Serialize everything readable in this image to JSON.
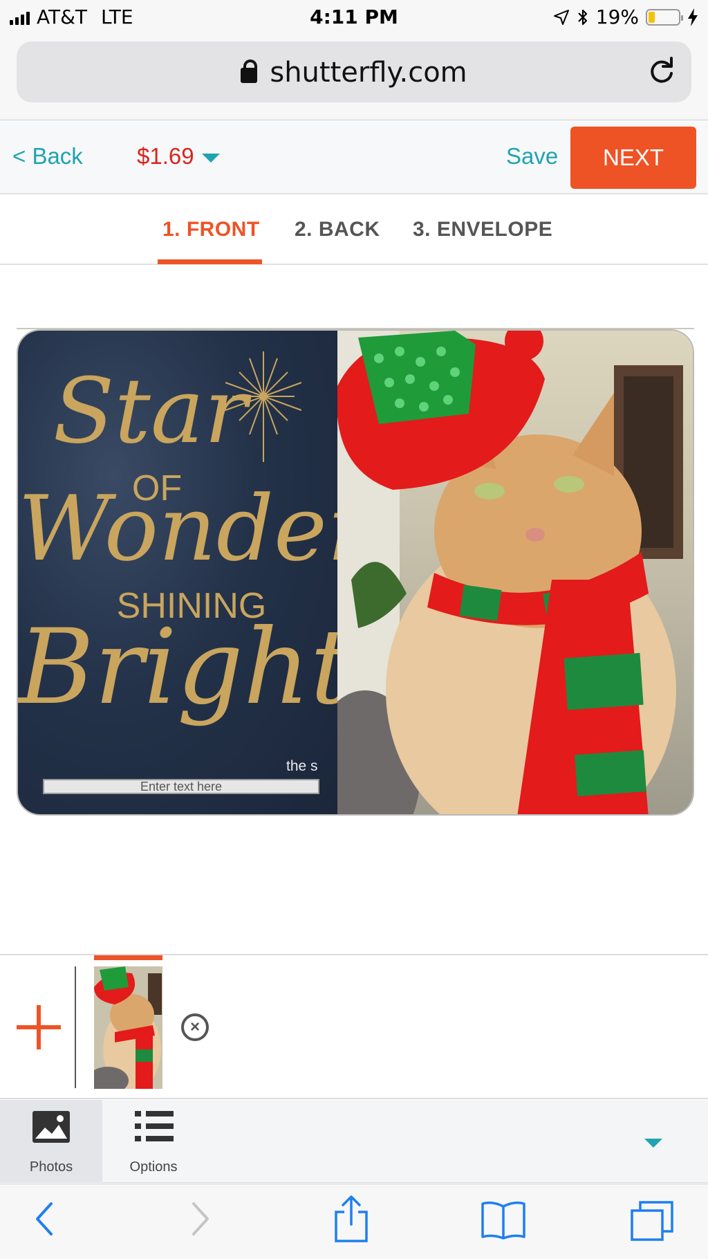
{
  "status_bar": {
    "carrier": "AT&T",
    "network": "LTE",
    "time": "4:11 PM",
    "battery_percent": "19%",
    "battery_level": 0.19,
    "icons": [
      "signal-bars-icon",
      "location-arrow-icon",
      "bluetooth-icon",
      "battery-icon",
      "charging-bolt-icon"
    ]
  },
  "browser": {
    "url": "shutterfly.com",
    "icons": [
      "lock-icon",
      "reload-icon"
    ]
  },
  "header": {
    "back_label": "< Back",
    "price": "$1.69",
    "save_label": "Save",
    "next_label": "NEXT"
  },
  "tabs": [
    {
      "label": "1. FRONT",
      "active": true
    },
    {
      "label": "2. BACK",
      "active": false
    },
    {
      "label": "3. ENVELOPE",
      "active": false
    }
  ],
  "card": {
    "text_line1": "Star",
    "text_line2": "OF",
    "text_line3": "Wonder",
    "text_line4": "SHINING",
    "text_line5": "Bright",
    "partial_text": "the s",
    "text_placeholder": "Enter text here"
  },
  "photo_tray": {
    "icons": [
      "add-photo-icon",
      "remove-photo-icon"
    ]
  },
  "tool_tabs": [
    {
      "label": "Photos",
      "icon": "photos-icon",
      "active": true
    },
    {
      "label": "Options",
      "icon": "list-icon",
      "active": false
    }
  ],
  "safari_toolbar": {
    "icons": [
      "back-arrow-icon",
      "forward-arrow-icon",
      "share-icon",
      "bookmarks-icon",
      "tabs-icon"
    ]
  },
  "colors": {
    "accent_orange": "#ee5325",
    "teal": "#1fa3b1",
    "price_red": "#d7261e",
    "gold": "#c9a55e",
    "navy": "#233249"
  }
}
